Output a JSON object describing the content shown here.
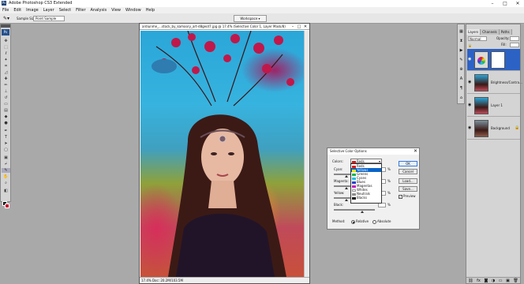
{
  "app": {
    "title": "Adobe Photoshop CS3 Extended"
  },
  "menu": [
    "File",
    "Edit",
    "Image",
    "Layer",
    "Select",
    "Filter",
    "Analysis",
    "View",
    "Window",
    "Help"
  ],
  "options_bar": {
    "sample_size_label": "Sample Size:",
    "sample_size_value": "Point Sample",
    "workspace_label": "Workspace ▾"
  },
  "document": {
    "title": "ardiunme_...stock_by_kamoory_art-d8geot7.jpg @ 17.4% (Selective Color 1, Layer Mask/8)",
    "status": "17.4%   Doc: 20.2M/103.5M"
  },
  "dialog": {
    "title": "Selective Color Options",
    "colors_label": "Colors:",
    "selected_color": "Reds",
    "color_options": [
      {
        "label": "Reds",
        "color": "#d81b1b"
      },
      {
        "label": "Yellows",
        "color": "#f2e20a"
      },
      {
        "label": "Greens",
        "color": "#21b24b"
      },
      {
        "label": "Cyans",
        "color": "#23c4d8"
      },
      {
        "label": "Blues",
        "color": "#2546c8"
      },
      {
        "label": "Magentas",
        "color": "#c01ec0"
      },
      {
        "label": "Whites",
        "color": "#ffffff"
      },
      {
        "label": "Neutrals",
        "color": "#8c8c8c"
      },
      {
        "label": "Blacks",
        "color": "#111111"
      }
    ],
    "highlighted_option": "Yellows",
    "sliders": [
      {
        "label": "Cyan:",
        "unit": "%"
      },
      {
        "label": "Magenta:",
        "unit": "%"
      },
      {
        "label": "Yellow:",
        "unit": "%"
      },
      {
        "label": "Black:",
        "unit": "%"
      }
    ],
    "buttons": {
      "ok": "OK",
      "cancel": "Cancel",
      "load": "Load...",
      "save": "Save..."
    },
    "preview_label": "Preview",
    "method_label": "Method:",
    "method_relative": "Relative",
    "method_absolute": "Absolute"
  },
  "layers_panel": {
    "tabs": [
      "Layers",
      "Channels",
      "Paths"
    ],
    "blend_mode": "Normal",
    "opacity_label": "Opacity:",
    "fill_label": "Fill:",
    "layers": [
      {
        "name": "",
        "selected": true
      },
      {
        "name": "Brightness/Contra...",
        "selected": false
      },
      {
        "name": "Layer 1",
        "selected": false
      },
      {
        "name": "Background",
        "selected": false
      }
    ]
  },
  "accent_colors": {
    "selection": "#2d62c5",
    "ok_border": "#3a78d6"
  }
}
